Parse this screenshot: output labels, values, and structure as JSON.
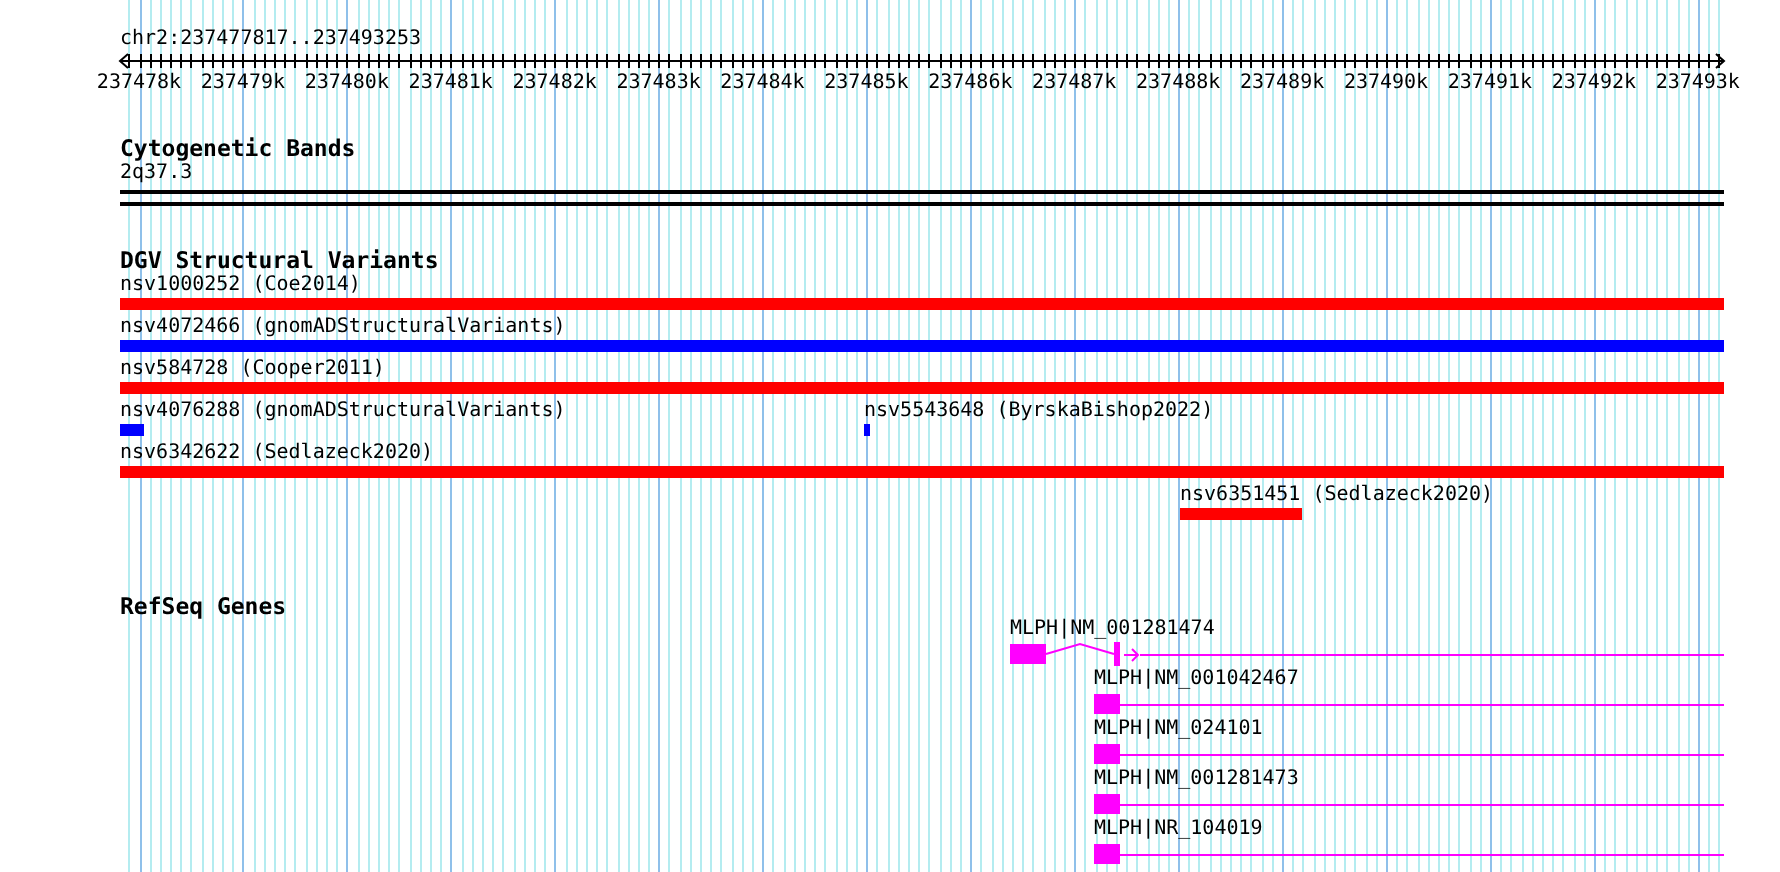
{
  "ruler": {
    "location": "chr2:237477817..237493253",
    "ticks": [
      "237478k",
      "237479k",
      "237480k",
      "237481k",
      "237482k",
      "237483k",
      "237484k",
      "237485k",
      "237486k",
      "237487k",
      "237488k",
      "237489k",
      "237490k",
      "237491k",
      "237492k",
      "237493k"
    ]
  },
  "tracks": [
    {
      "kind": "bands",
      "title": "Cytogenetic Bands",
      "features": [
        {
          "label": "2q37.3"
        }
      ]
    },
    {
      "kind": "variants",
      "title": "DGV Structural Variants",
      "rows": [
        {
          "features": [
            {
              "label": "nsv1000252 (Coe2014)",
              "color": "#ff0000"
            }
          ]
        },
        {
          "features": [
            {
              "label": "nsv4072466 (gnomADStructuralVariants)",
              "color": "#0000ff"
            }
          ]
        },
        {
          "features": [
            {
              "label": "nsv584728 (Cooper2011)",
              "color": "#ff0000"
            }
          ]
        },
        {
          "features": [
            {
              "label": "nsv4076288 (gnomADStructuralVariants)",
              "color": "#0000ff"
            },
            {
              "label": "nsv5543648 (ByrskaBishop2022)",
              "color": "#0000ff"
            }
          ]
        },
        {
          "features": [
            {
              "label": "nsv6342622 (Sedlazeck2020)",
              "color": "#ff0000"
            }
          ]
        },
        {
          "features": [
            {
              "label": "nsv6351451 (Sedlazeck2020)",
              "color": "#ff0000"
            }
          ]
        }
      ]
    },
    {
      "kind": "genes",
      "title": "RefSeq Genes",
      "features": [
        {
          "label": "MLPH|NM_001281474"
        },
        {
          "label": "MLPH|NM_001042467"
        },
        {
          "label": "MLPH|NM_024101"
        },
        {
          "label": "MLPH|NM_001281473"
        },
        {
          "label": "MLPH|NR_104019"
        }
      ]
    }
  ]
}
